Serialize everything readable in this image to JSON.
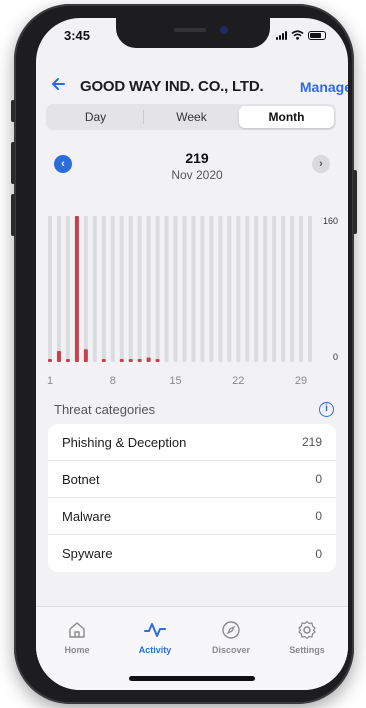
{
  "status": {
    "time": "3:45"
  },
  "header": {
    "back_icon": "back-arrow-icon",
    "title": "GOOD WAY IND. CO., LTD.",
    "manage": "Manage"
  },
  "segments": {
    "items": [
      "Day",
      "Week",
      "Month"
    ],
    "selected": "Month"
  },
  "summary": {
    "total": "219",
    "period": "Nov 2020"
  },
  "chart_data": {
    "type": "bar",
    "x": [
      1,
      2,
      3,
      4,
      5,
      6,
      7,
      8,
      9,
      10,
      11,
      12,
      13,
      14,
      15,
      16,
      17,
      18,
      19,
      20,
      21,
      22,
      23,
      24,
      25,
      26,
      27,
      28,
      29,
      30
    ],
    "values": [
      2,
      12,
      3,
      160,
      14,
      0,
      3,
      0,
      2,
      3,
      3,
      5,
      3,
      0,
      0,
      0,
      0,
      0,
      0,
      0,
      0,
      0,
      0,
      0,
      0,
      0,
      0,
      0,
      0,
      0
    ],
    "tick_labels": [
      "1",
      "8",
      "15",
      "22",
      "29"
    ],
    "y_labels": [
      "160",
      "0"
    ],
    "ylim": [
      0,
      160
    ],
    "bar_color": "#c8404a",
    "track_color": "#dcdce0"
  },
  "threats": {
    "heading": "Threat categories",
    "items": [
      {
        "name": "Phishing & Deception",
        "count": "219"
      },
      {
        "name": "Botnet",
        "count": "0"
      },
      {
        "name": "Malware",
        "count": "0"
      },
      {
        "name": "Spyware",
        "count": "0"
      }
    ]
  },
  "tabs": [
    {
      "label": "Home",
      "icon": "home-icon"
    },
    {
      "label": "Activity",
      "icon": "activity-icon"
    },
    {
      "label": "Discover",
      "icon": "compass-icon"
    },
    {
      "label": "Settings",
      "icon": "gear-icon"
    }
  ],
  "colors": {
    "accent": "#2d6cdf",
    "threat": "#c8404a"
  }
}
